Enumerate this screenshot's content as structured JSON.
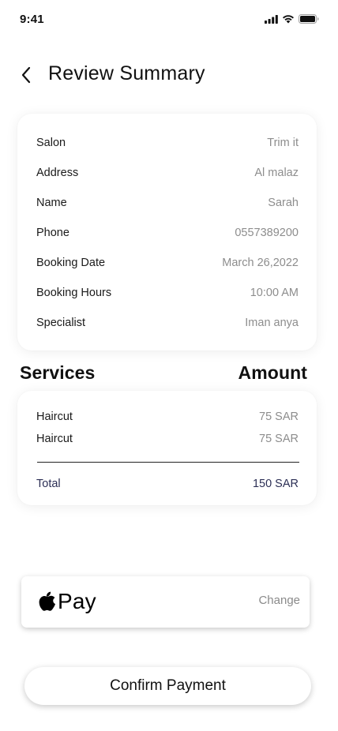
{
  "status_bar": {
    "time": "9:41"
  },
  "header": {
    "title": "Review Summary"
  },
  "summary": [
    {
      "label": "Salon",
      "value": "Trim it"
    },
    {
      "label": "Address",
      "value": "Al malaz"
    },
    {
      "label": "Name",
      "value": "Sarah"
    },
    {
      "label": "Phone",
      "value": "0557389200"
    },
    {
      "label": "Booking Date",
      "value": "March 26,2022"
    },
    {
      "label": "Booking Hours",
      "value": "10:00 AM"
    },
    {
      "label": "Specialist",
      "value": "Iman anya"
    }
  ],
  "services_section": {
    "services_label": "Services",
    "amount_label": "Amount"
  },
  "services": [
    {
      "name": "Haircut",
      "amount": "75 SAR"
    },
    {
      "name": "Haircut",
      "amount": "75 SAR"
    }
  ],
  "total": {
    "label": "Total",
    "amount": "150 SAR"
  },
  "payment": {
    "method_text": "Pay",
    "change_label": "Change",
    "icon": "apple-logo-icon"
  },
  "confirm": {
    "label": "Confirm Payment"
  }
}
